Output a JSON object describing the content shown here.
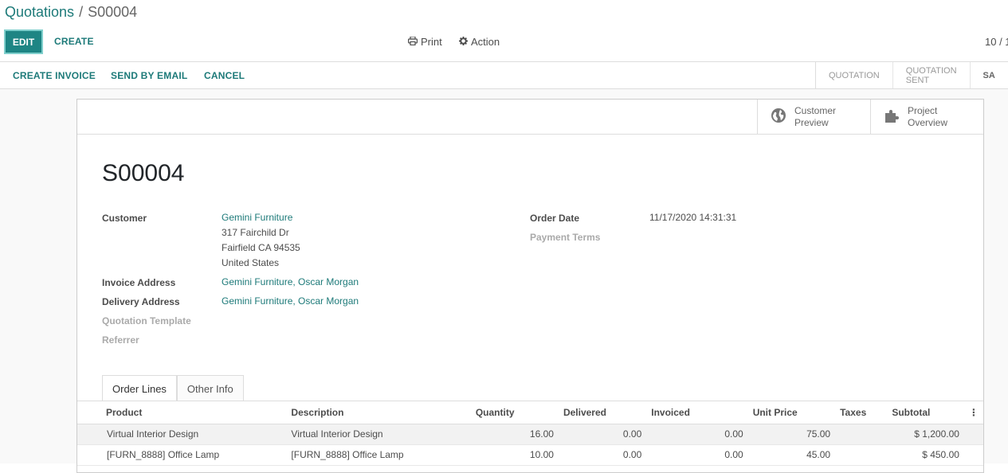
{
  "breadcrumb": {
    "parent": "Quotations",
    "separator": "/",
    "current": "S00004"
  },
  "toolbar": {
    "edit_label": "EDIT",
    "create_label": "CREATE",
    "print_label": "Print",
    "action_label": "Action",
    "pager": "10 / 1"
  },
  "statusbar": {
    "buttons": [
      "CREATE INVOICE",
      "SEND BY EMAIL",
      "CANCEL"
    ],
    "stages": [
      "QUOTATION",
      "QUOTATION SENT",
      "SA"
    ]
  },
  "smart_buttons": [
    {
      "line1": "Customer",
      "line2": "Preview",
      "icon": "globe-icon"
    },
    {
      "line1": "Project",
      "line2": "Overview",
      "icon": "puzzle-icon"
    }
  ],
  "form": {
    "title": "S00004",
    "customer_label": "Customer",
    "customer_name": "Gemini Furniture",
    "customer_street": "317 Fairchild Dr",
    "customer_city": "Fairfield CA 94535",
    "customer_country": "United States",
    "invoice_address_label": "Invoice Address",
    "invoice_address": "Gemini Furniture, Oscar Morgan",
    "delivery_address_label": "Delivery Address",
    "delivery_address": "Gemini Furniture, Oscar Morgan",
    "quotation_template_label": "Quotation Template",
    "referrer_label": "Referrer",
    "order_date_label": "Order Date",
    "order_date": "11/17/2020 14:31:31",
    "payment_terms_label": "Payment Terms"
  },
  "tabs": [
    "Order Lines",
    "Other Info"
  ],
  "order_lines": {
    "columns": [
      "Product",
      "Description",
      "Quantity",
      "Delivered",
      "Invoiced",
      "Unit Price",
      "Taxes",
      "Subtotal"
    ],
    "rows": [
      {
        "product": "Virtual Interior Design",
        "description": "Virtual Interior Design",
        "quantity": "16.00",
        "delivered": "0.00",
        "invoiced": "0.00",
        "unit_price": "75.00",
        "taxes": "",
        "subtotal": "$ 1,200.00"
      },
      {
        "product": "[FURN_8888] Office Lamp",
        "description": "[FURN_8888] Office Lamp",
        "quantity": "10.00",
        "delivered": "0.00",
        "invoiced": "0.00",
        "unit_price": "45.00",
        "taxes": "",
        "subtotal": "$ 450.00"
      }
    ]
  },
  "colors": {
    "accent": "#1e8584",
    "link": "#1d7a79"
  }
}
